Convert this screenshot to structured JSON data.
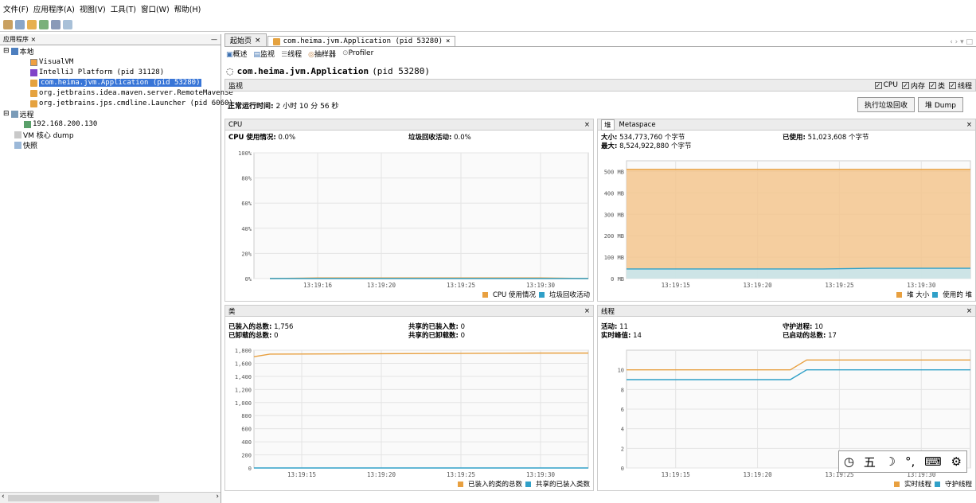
{
  "menu": [
    "文件(F)",
    "应用程序(A)",
    "视图(V)",
    "工具(T)",
    "窗口(W)",
    "帮助(H)"
  ],
  "left_panel": {
    "tab": "应用程序",
    "tree": [
      {
        "label": "本地",
        "icon": "host-icon"
      },
      {
        "label": "VisualVM",
        "icon": "visualvm-icon"
      },
      {
        "label": "IntelliJ Platform (pid 31128)",
        "icon": "intellij-icon"
      },
      {
        "label": "com.heima.jvm.Application (pid 53280)",
        "icon": "java-icon"
      },
      {
        "label": "org.jetbrains.idea.maven.server.RemoteMavenSe",
        "icon": "java-icon"
      },
      {
        "label": "org.jetbrains.jps.cmdline.Launcher (pid 6060)",
        "icon": "java-icon"
      },
      {
        "label": "远程",
        "icon": "remote-icon"
      },
      {
        "label": "192.168.200.130",
        "icon": "host-icon"
      },
      {
        "label": "VM 核心 dump",
        "icon": "core-dump-icon"
      },
      {
        "label": "快照",
        "icon": "snapshot-icon"
      }
    ]
  },
  "doc_tabs": [
    {
      "label": "起始页"
    },
    {
      "label": "com.heima.jvm.Application (pid 53280)"
    }
  ],
  "sub_tabs": [
    "概述",
    "监视",
    "线程",
    "抽样器",
    "Profiler"
  ],
  "app": {
    "name": "com.heima.jvm.Application",
    "pid": "(pid 53280)"
  },
  "monitor": {
    "label": "监视",
    "checkboxes": [
      "CPU",
      "内存",
      "类",
      "线程"
    ],
    "uptime_label": "正常运行时间:",
    "uptime_value": "2 小时 10 分 56 秒",
    "gc_button": "执行垃圾回收",
    "dump_button": "堆 Dump"
  },
  "cpu_panel": {
    "title": "CPU",
    "stats": [
      [
        "CPU 使用情况:",
        "0.0%"
      ],
      [
        "垃圾回收活动:",
        "0.0%"
      ]
    ],
    "y_ticks": [
      "100%",
      "80%",
      "60%",
      "40%",
      "20%",
      "0%"
    ],
    "x_ticks": [
      "13:19:16",
      "13:19:20",
      "13:19:25",
      "13:19:30"
    ],
    "legend": [
      "CPU 使用情况",
      "垃圾回收活动"
    ]
  },
  "heap_panel": {
    "tabs": [
      "堆",
      "Metaspace"
    ],
    "stats": [
      [
        "大小:",
        "534,773,760 个字节"
      ],
      [
        "最大:",
        "8,524,922,880 个字节"
      ],
      [
        "已使用:",
        "51,023,608 个字节"
      ]
    ],
    "y_ticks": [
      "500 MB",
      "400 MB",
      "300 MB",
      "200 MB",
      "100 MB",
      "0 MB"
    ],
    "x_ticks": [
      "13:19:15",
      "13:19:20",
      "13:19:25",
      "13:19:30"
    ],
    "legend": [
      "堆 大小",
      "使用的 堆"
    ]
  },
  "classes_panel": {
    "title": "类",
    "stats": [
      [
        "已装入的总数:",
        "1,756"
      ],
      [
        "已卸载的总数:",
        "0"
      ],
      [
        "共享的已装入数:",
        "0"
      ],
      [
        "共享的已卸载数:",
        "0"
      ]
    ],
    "y_ticks": [
      "1,800",
      "1,600",
      "1,400",
      "1,200",
      "1,000",
      "800",
      "600",
      "400",
      "200",
      "0"
    ],
    "x_ticks": [
      "13:19:15",
      "13:19:20",
      "13:19:25",
      "13:19:30"
    ],
    "legend": [
      "已装入的类的总数",
      "共享的已装入类数"
    ]
  },
  "threads_panel": {
    "title": "线程",
    "stats": [
      [
        "活动:",
        "11"
      ],
      [
        "实时峰值:",
        "14"
      ],
      [
        "守护进程:",
        "10"
      ],
      [
        "已启动的总数:",
        "17"
      ]
    ],
    "y_ticks": [
      "10",
      "8",
      "6",
      "4",
      "2",
      "0"
    ],
    "x_ticks": [
      "13:19:15",
      "13:19:20",
      "13:19:25",
      "13:19:30"
    ],
    "legend": [
      "实时线程",
      "守护线程"
    ]
  },
  "ime": [
    "五",
    "☽",
    "°,",
    "⌨",
    "⚙"
  ],
  "colors": {
    "orange": "#e8a040",
    "blue": "#30a0c8",
    "fill_orange": "#f3c58e",
    "fill_blue": "#c6e8f2"
  },
  "chart_data": [
    {
      "type": "area",
      "title": "CPU",
      "ylim": [
        0,
        100
      ],
      "series": [
        {
          "name": "CPU 使用情况",
          "x": [
            "13:19:13",
            "13:19:16",
            "13:19:20",
            "13:19:25",
            "13:19:30",
            "13:19:33"
          ],
          "values": [
            0,
            0.5,
            0.5,
            0.5,
            0.5,
            0
          ]
        },
        {
          "name": "垃圾回收活动",
          "x": [
            "13:19:13",
            "13:19:33"
          ],
          "values": [
            0,
            0
          ]
        }
      ]
    },
    {
      "type": "area",
      "title": "堆",
      "ylim": [
        0,
        550
      ],
      "series": [
        {
          "name": "堆 大小",
          "x": [
            "13:19:12",
            "13:19:33"
          ],
          "values": [
            510,
            510
          ]
        },
        {
          "name": "使用的 堆",
          "x": [
            "13:19:12",
            "13:19:24",
            "13:19:27",
            "13:19:33"
          ],
          "values": [
            45,
            45,
            48,
            48
          ]
        }
      ]
    },
    {
      "type": "line",
      "title": "类",
      "ylim": [
        0,
        1800
      ],
      "series": [
        {
          "name": "已装入的类的总数",
          "x": [
            "13:19:12",
            "13:19:13",
            "13:19:30",
            "13:19:33"
          ],
          "values": [
            1700,
            1740,
            1756,
            1756
          ]
        },
        {
          "name": "共享的已装入类数",
          "x": [
            "13:19:12",
            "13:19:33"
          ],
          "values": [
            0,
            0
          ]
        }
      ]
    },
    {
      "type": "line",
      "title": "线程",
      "ylim": [
        0,
        12
      ],
      "series": [
        {
          "name": "实时线程",
          "x": [
            "13:19:12",
            "13:19:22",
            "13:19:23",
            "13:19:33"
          ],
          "values": [
            10,
            10,
            11,
            11
          ]
        },
        {
          "name": "守护线程",
          "x": [
            "13:19:12",
            "13:19:22",
            "13:19:23",
            "13:19:33"
          ],
          "values": [
            9,
            9,
            10,
            10
          ]
        }
      ]
    }
  ]
}
